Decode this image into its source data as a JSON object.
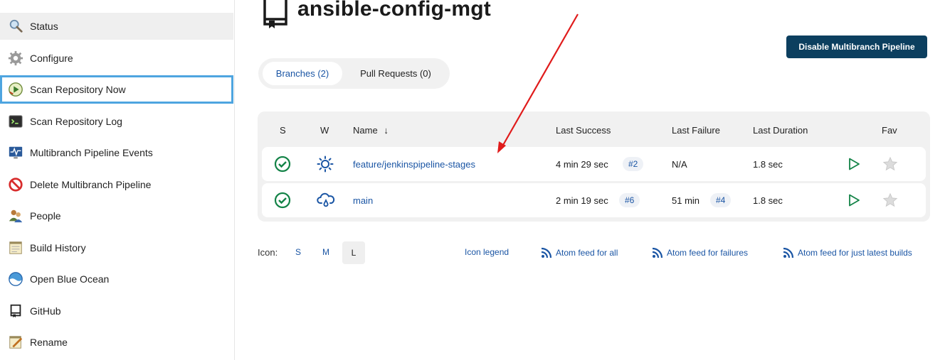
{
  "sidebar": {
    "items": [
      {
        "label": "Status",
        "icon": "magnifier-icon"
      },
      {
        "label": "Configure",
        "icon": "gear-icon"
      },
      {
        "label": "Scan Repository Now",
        "icon": "clock-play-icon"
      },
      {
        "label": "Scan Repository Log",
        "icon": "terminal-icon"
      },
      {
        "label": "Multibranch Pipeline Events",
        "icon": "monitor-pulse-icon"
      },
      {
        "label": "Delete Multibranch Pipeline",
        "icon": "no-entry-icon"
      },
      {
        "label": "People",
        "icon": "people-icon"
      },
      {
        "label": "Build History",
        "icon": "notepad-icon"
      },
      {
        "label": "Open Blue Ocean",
        "icon": "blue-ocean-icon"
      },
      {
        "label": "GitHub",
        "icon": "repo-icon"
      },
      {
        "label": "Rename",
        "icon": "notepad-pencil-icon"
      }
    ]
  },
  "header": {
    "title": "ansible-config-mgt",
    "disable_button": "Disable Multibranch Pipeline"
  },
  "tabs": [
    {
      "label": "Branches (2)",
      "selected": true
    },
    {
      "label": "Pull Requests (0)",
      "selected": false
    }
  ],
  "table": {
    "columns": {
      "s": "S",
      "w": "W",
      "name": "Name",
      "sort_indicator": "↓",
      "last_success": "Last Success",
      "last_failure": "Last Failure",
      "last_duration": "Last Duration",
      "fav": "Fav"
    },
    "rows": [
      {
        "status": "success",
        "weather": "sunny",
        "name": "feature/jenkinspipeline-stages",
        "last_success": "4 min 29 sec",
        "last_success_build": "#2",
        "last_failure": "N/A",
        "last_failure_build": "",
        "last_duration": "1.8 sec"
      },
      {
        "status": "success",
        "weather": "rain",
        "name": "main",
        "last_success": "2 min 19 sec",
        "last_success_build": "#6",
        "last_failure": "51 min",
        "last_failure_build": "#4",
        "last_duration": "1.8 sec"
      }
    ]
  },
  "footer": {
    "icon_label": "Icon:",
    "sizes": [
      "S",
      "M",
      "L"
    ],
    "selected_size": "L",
    "icon_legend": "Icon legend",
    "feed_all": "Atom feed for all",
    "feed_failures": "Atom feed for failures",
    "feed_latest": "Atom feed for just latest builds"
  },
  "colors": {
    "accent_button": "#0c3f5f",
    "link": "#1a55a4",
    "success": "#138347",
    "annotation_arrow": "#e01b1b"
  }
}
